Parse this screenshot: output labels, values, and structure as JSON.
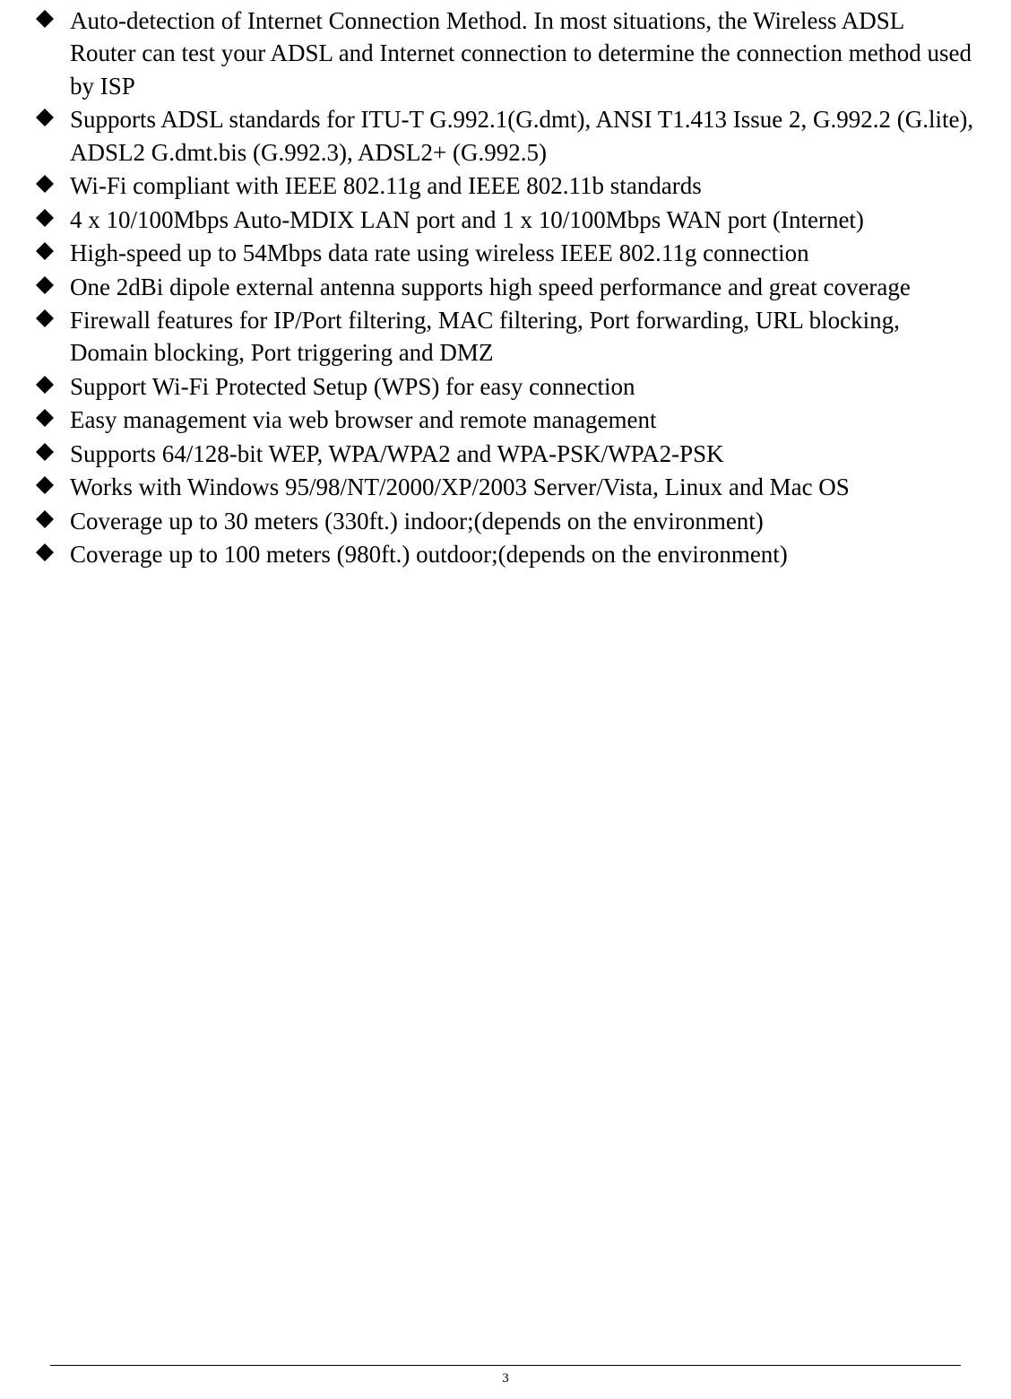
{
  "features": [
    "Auto-detection of Internet Connection Method. In most situations, the Wireless ADSL Router can test your ADSL and Internet connection to determine the connection method used by ISP",
    "Supports ADSL standards for ITU-T G.992.1(G.dmt), ANSI T1.413 Issue 2, G.992.2 (G.lite), ADSL2 G.dmt.bis (G.992.3), ADSL2+ (G.992.5)",
    "Wi-Fi compliant with IEEE 802.11g and IEEE 802.11b standards",
    "4 x 10/100Mbps Auto-MDIX LAN port and 1 x 10/100Mbps WAN port (Internet)",
    "High-speed up to 54Mbps data rate using wireless IEEE 802.11g connection",
    "One 2dBi dipole external antenna supports high speed performance and great coverage",
    "Firewall features for IP/Port filtering, MAC filtering, Port forwarding, URL blocking, Domain blocking, Port triggering and DMZ",
    "Support Wi-Fi Protected Setup (WPS) for easy connection",
    "Easy management via web browser and remote management",
    "Supports 64/128-bit WEP, WPA/WPA2 and WPA-PSK/WPA2-PSK",
    "Works with Windows 95/98/NT/2000/XP/2003 Server/Vista, Linux and Mac OS",
    "Coverage up to 30 meters (330ft.) indoor;(depends on the environment)",
    "Coverage up to 100 meters (980ft.) outdoor;(depends on the environment)"
  ],
  "page_number": "3"
}
